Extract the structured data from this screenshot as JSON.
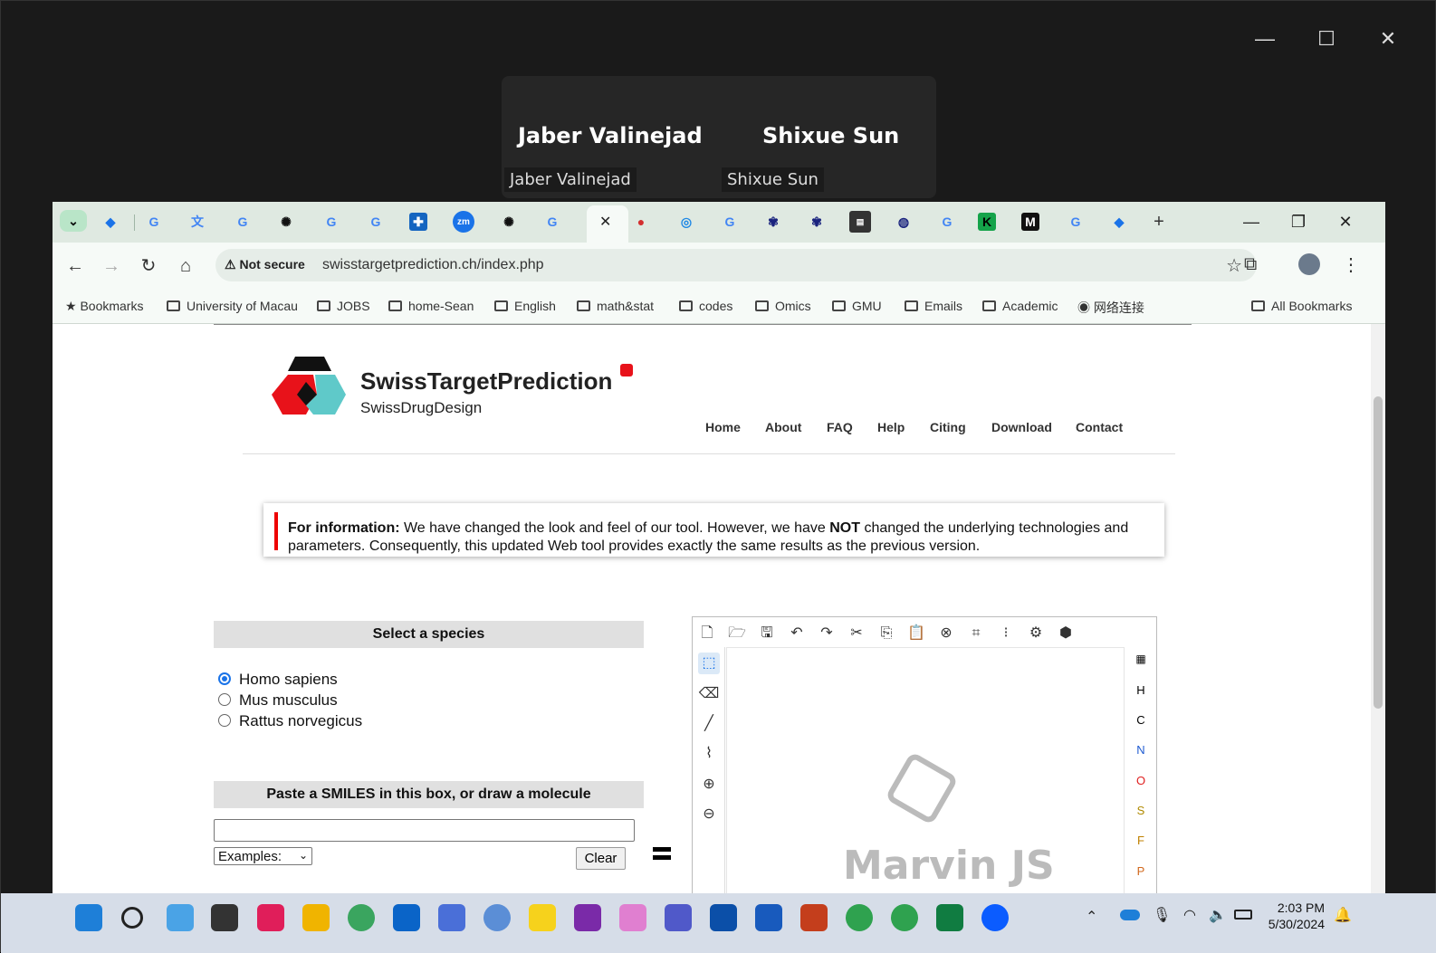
{
  "meeting": {
    "participants": [
      {
        "display": "Jaber Valinejad",
        "tag": "Jaber Valinejad"
      },
      {
        "display": "Shixue Sun",
        "tag": "Shixue Sun"
      }
    ]
  },
  "outer_window": {
    "minimize": "—",
    "maximize": "☐",
    "close": "✕"
  },
  "browser": {
    "active_tab_close": "✕",
    "new_tab": "+",
    "window_buttons": {
      "minimize": "—",
      "restore": "❐",
      "close": "✕"
    },
    "nav": {
      "back": "←",
      "forward": "→",
      "reload": "↻",
      "home": "⌂"
    },
    "security": "Not secure",
    "url": "swisstargetprediction.ch/index.php",
    "bookmarks": [
      "Bookmarks",
      "University of Macau",
      "JOBS",
      "home-Sean",
      "English",
      "math&stat",
      "codes",
      "Omics",
      "GMU",
      "Emails",
      "Academic",
      "网络连接"
    ],
    "all_bookmarks": "All Bookmarks"
  },
  "site": {
    "title": "SwissTargetPrediction",
    "subtitle": "SwissDrugDesign",
    "menu": [
      "Home",
      "About",
      "FAQ",
      "Help",
      "Citing",
      "Download",
      "Contact"
    ],
    "info_bold": "For information:",
    "info_text1": " We have changed the look and feel of our tool. However, we have ",
    "info_not": "NOT",
    "info_text2": " changed the underlying technologies and parameters. Consequently, this updated Web tool provides exactly the same results as the previous version.",
    "species_header": "Select a species",
    "species": [
      {
        "label": "Homo sapiens",
        "selected": true
      },
      {
        "label": "Mus musculus",
        "selected": false
      },
      {
        "label": "Rattus norvegicus",
        "selected": false
      }
    ],
    "smiles_header": "Paste a SMILES in this box, or draw a molecule",
    "smiles_value": "",
    "examples_select": "Examples:",
    "clear_button": "Clear"
  },
  "marvin": {
    "elements": [
      "H",
      "C",
      "N",
      "O",
      "S",
      "F",
      "P"
    ],
    "logo_text": "Marvin JS"
  },
  "taskbar": {
    "time": "2:03 PM",
    "date": "5/30/2024"
  },
  "colors": {
    "accent": "#1a73e8",
    "info_bar": "#ee0000",
    "element_N": "#1f5bd1",
    "element_O": "#e02020",
    "element_S": "#b08a00",
    "element_F": "#c08000",
    "element_P": "#d2691e"
  }
}
